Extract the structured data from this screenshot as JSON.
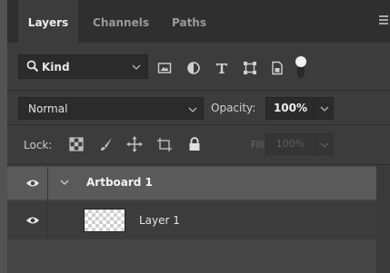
{
  "tabs": [
    {
      "label": "Layers",
      "active": true
    },
    {
      "label": "Channels",
      "active": false
    },
    {
      "label": "Paths",
      "active": false
    }
  ],
  "panel_menu_icon": "hamburger-menu-icon",
  "filter": {
    "kind_label": "Kind",
    "icons": [
      "pixel-layer-filter-icon",
      "adjustment-layer-filter-icon",
      "type-layer-filter-icon",
      "shape-layer-filter-icon",
      "smart-object-filter-icon",
      "filter-toggle-icon"
    ]
  },
  "blend": {
    "mode": "Normal",
    "opacity_label": "Opacity:",
    "opacity_value": "100%"
  },
  "lock": {
    "label": "Lock:",
    "icons": [
      "lock-transparent-pixels-icon",
      "lock-image-pixels-icon",
      "lock-position-icon",
      "lock-artboard-nesting-icon",
      "lock-all-icon"
    ],
    "fill_label": "Fill:",
    "fill_value": "100%"
  },
  "layers": [
    {
      "name": "Artboard 1",
      "type": "artboard",
      "visible": true,
      "expanded": true,
      "selected": true
    },
    {
      "name": "Layer 1",
      "type": "pixel",
      "visible": true,
      "selected": false
    }
  ],
  "colors": {
    "panel_bg": "#3c3c3c",
    "tab_strip_bg": "#2f2f2f",
    "selected_row_bg": "#5a5a5a",
    "field_bg": "#2b2b2b"
  }
}
